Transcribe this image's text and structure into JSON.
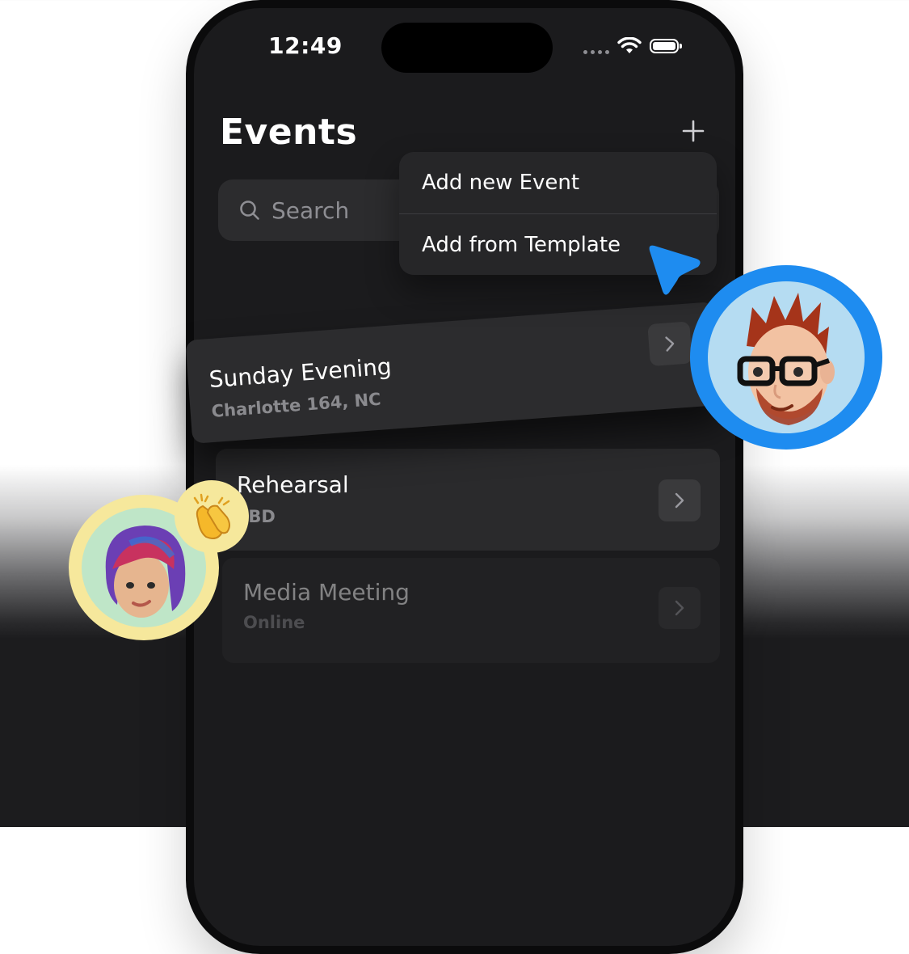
{
  "status_bar": {
    "time": "12:49",
    "icons": [
      "signal-dots-icon",
      "wifi-icon",
      "battery-icon"
    ]
  },
  "header": {
    "title": "Events",
    "add_icon": "plus-icon"
  },
  "search": {
    "placeholder": "Search",
    "icon": "search-icon"
  },
  "menu": {
    "items": [
      {
        "label": "Add new Event"
      },
      {
        "label": "Add from Template"
      }
    ]
  },
  "events": [
    {
      "title": "Sunday Evening",
      "subtitle": "Charlotte 164, NC"
    },
    {
      "title": "Rehearsal",
      "subtitle": "TBD"
    },
    {
      "title": "Media Meeting",
      "subtitle": "Online"
    }
  ],
  "colors": {
    "accent_blue": "#1e8cf0",
    "avatar_yellow": "#f6e89c",
    "screen_bg": "#1b1b1d",
    "card_bg": "#2a2a2c"
  },
  "decorations": {
    "cursor": "pointer-cursor-icon",
    "avatar_1": "memoji-man-glasses-avatar",
    "avatar_2": "memoji-woman-purple-hair-avatar",
    "reaction": "clapping-hands-icon"
  }
}
